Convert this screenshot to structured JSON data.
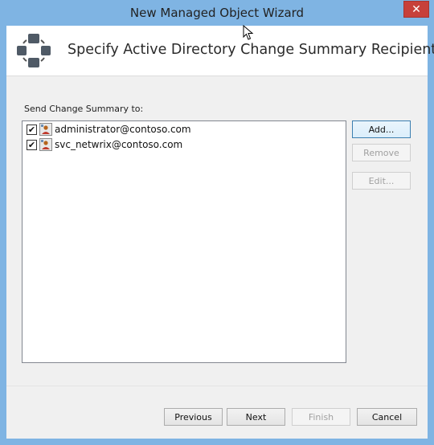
{
  "window": {
    "title": "New Managed Object Wizard",
    "close_glyph": "✕"
  },
  "header": {
    "title": "Specify Active Directory Change Summary Recipients",
    "icon": "managed-object-wizard-icon"
  },
  "recipients": {
    "label": "Send Change Summary to:",
    "items": [
      {
        "email": "administrator@contoso.com",
        "checked": true,
        "icon": "user-icon"
      },
      {
        "email": "svc_netwrix@contoso.com",
        "checked": true,
        "icon": "user-icon"
      }
    ]
  },
  "side_buttons": {
    "add": "Add...",
    "remove": "Remove",
    "edit": "Edit..."
  },
  "footer": {
    "previous": "Previous",
    "next": "Next",
    "finish": "Finish",
    "cancel": "Cancel"
  },
  "colors": {
    "title_bar": "#7fb4e3",
    "close_button": "#c7403a",
    "dialog_background": "#f0f0f0"
  }
}
